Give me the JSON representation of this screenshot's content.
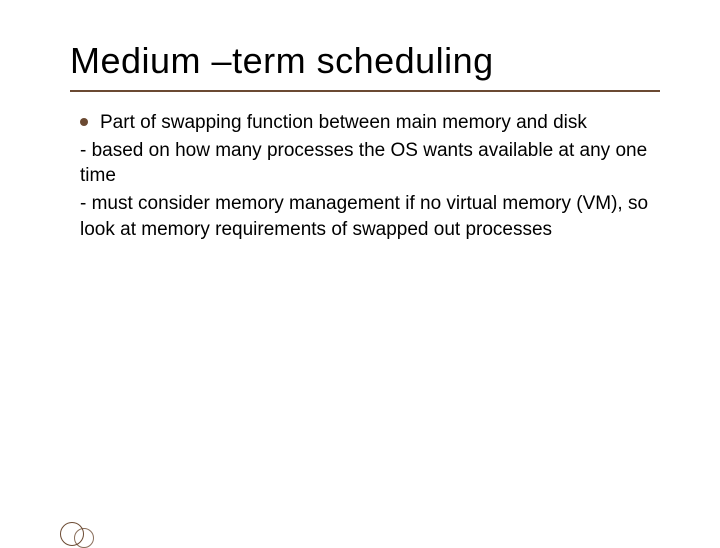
{
  "slide": {
    "title": "Medium –term scheduling",
    "bullet": "Part of swapping function between main memory and disk",
    "line1": "- based on how many processes the OS wants available at any one time",
    "line2": "- must consider memory management if no virtual memory (VM), so look at memory requirements of swapped out processes"
  }
}
